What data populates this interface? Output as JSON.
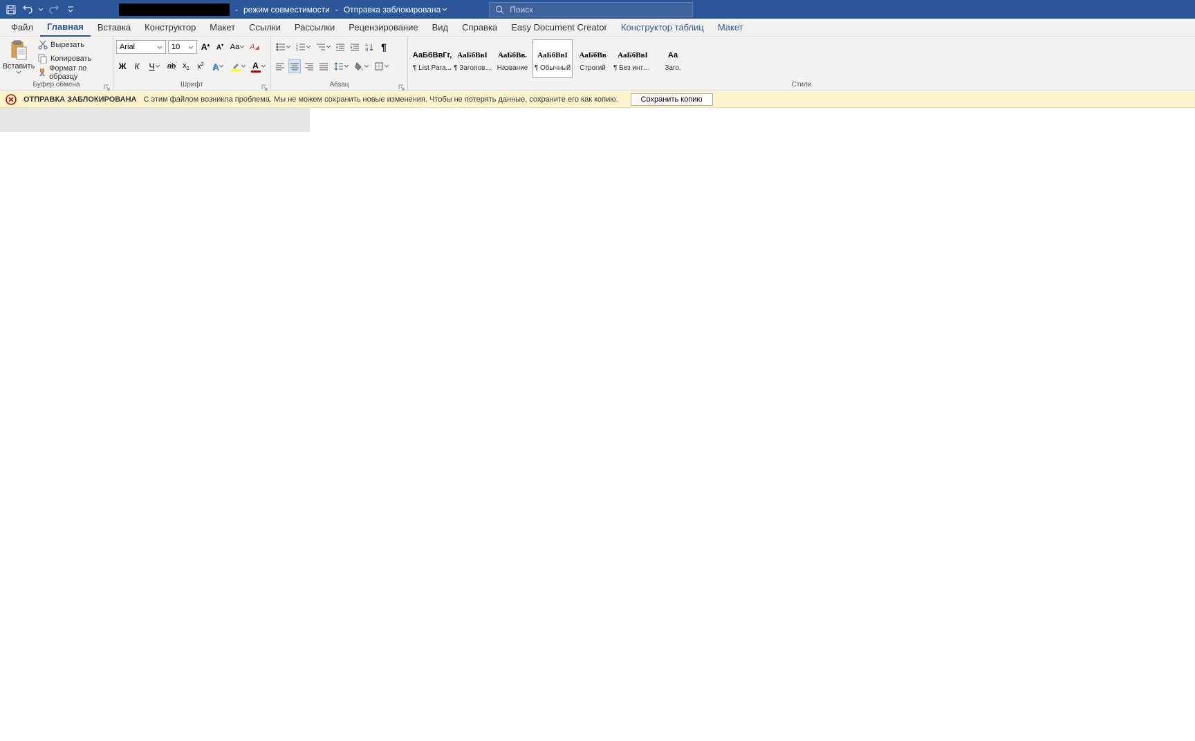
{
  "titlebar": {
    "compat_mode": "режим совместимости",
    "upload_blocked": "Отправка заблокирована",
    "search_placeholder": "Поиск"
  },
  "tabs": {
    "file": "Файл",
    "home": "Главная",
    "insert": "Вставка",
    "design": "Конструктор",
    "layout": "Макет",
    "references": "Ссылки",
    "mailings": "Рассылки",
    "review": "Рецензирование",
    "view": "Вид",
    "help": "Справка",
    "edc": "Easy Document Creator",
    "table_design": "Конструктор таблиц",
    "table_layout": "Макет"
  },
  "clipboard": {
    "paste": "Вставить",
    "cut": "Вырезать",
    "copy": "Копировать",
    "format_painter": "Формат по образцу",
    "group_label": "Буфер обмена"
  },
  "font": {
    "name": "Arial",
    "size": "10",
    "group_label": "Шрифт",
    "bold": "Ж",
    "italic": "К",
    "underline": "Ч",
    "change_case": "Aa"
  },
  "paragraph": {
    "group_label": "Абзац"
  },
  "styles": {
    "group_label": "Стили",
    "items": [
      {
        "preview": "АаБбВвГг,",
        "name": "¶ List Para...",
        "serif": false
      },
      {
        "preview": "АаБбВвІ",
        "name": "¶ Заголов...",
        "serif": true
      },
      {
        "preview": "АаБбВв.",
        "name": "Название",
        "serif": true,
        "bold": true
      },
      {
        "preview": "АаБбВвІ",
        "name": "¶ Обычный",
        "serif": true,
        "selected": true
      },
      {
        "preview": "АаБбВв",
        "name": "Строгий",
        "serif": true,
        "bold": true
      },
      {
        "preview": "АаБбВвІ",
        "name": "¶ Без инте...",
        "serif": true
      },
      {
        "preview": "Аа",
        "name": "Заго.",
        "serif": false
      }
    ]
  },
  "warning": {
    "title": "ОТПРАВКА ЗАБЛОКИРОВАНА",
    "message": "С этим файлом возникла проблема. Мы не можем сохранить новые изменения. Чтобы не потерять данные, сохраните его как копию.",
    "button": "Сохранить копию"
  }
}
